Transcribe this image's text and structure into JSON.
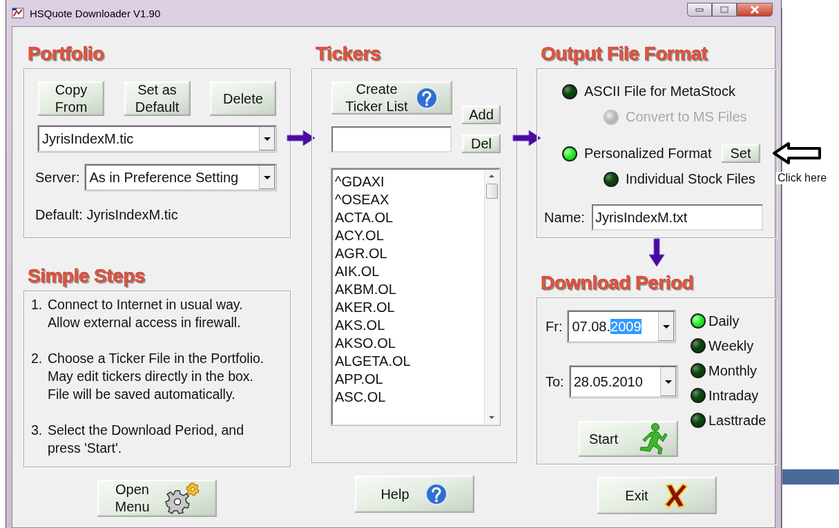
{
  "window": {
    "title": "HSQuote Downloader V1.90"
  },
  "portfolio": {
    "heading": "Portfolio",
    "buttons": [
      {
        "lines": [
          "Copy",
          "From"
        ]
      },
      {
        "lines": [
          "Set as",
          "Default"
        ]
      },
      {
        "lines": [
          "Delete"
        ]
      }
    ],
    "file_select": {
      "value": "JyrisIndexM.tic"
    },
    "server": {
      "label": "Server:",
      "value": "As in Preference Setting"
    },
    "default_text": "Default: JyrisIndexM.tic"
  },
  "simple_steps": {
    "heading": "Simple Steps",
    "steps": [
      {
        "number": "1.",
        "lines": [
          "Connect to Internet in usual way.",
          "Allow external access in firewall."
        ]
      },
      {
        "number": "2.",
        "lines": [
          "Choose a Ticker File in the Portfolio.",
          "May edit tickers directly in the box.",
          "File will be saved automatically."
        ]
      },
      {
        "number": "3.",
        "lines": [
          "Select the Download Period, and",
          "press 'Start'."
        ]
      }
    ]
  },
  "tickers": {
    "heading": "Tickers",
    "create_button": [
      "Create",
      "Ticker List"
    ],
    "add_button": "Add",
    "del_button": "Del",
    "list": [
      "^GDAXI",
      "^OSEAX",
      "ACTA.OL",
      "ACY.OL",
      "AGR.OL",
      "AIK.OL",
      "AKBM.OL",
      "AKER.OL",
      "AKS.OL",
      "AKSO.OL",
      "ALGETA.OL",
      "APP.OL",
      "ASC.OL"
    ]
  },
  "output_format": {
    "heading": "Output File Format",
    "options": [
      {
        "label": "ASCII File for MetaStock",
        "selected": false,
        "disabled": false,
        "children": [
          {
            "label": "Convert to MS Files",
            "selected": false,
            "disabled": true
          }
        ]
      },
      {
        "label": "Personalized Format",
        "selected": true,
        "disabled": false,
        "button": "Set",
        "children": [
          {
            "label": "Individual Stock Files",
            "selected": false,
            "disabled": false
          }
        ]
      }
    ],
    "name_field": {
      "label": "Name:",
      "value": "JyrisIndexM.txt"
    }
  },
  "download_period": {
    "heading": "Download Period",
    "from": {
      "label": "Fr:",
      "value_parts": [
        {
          "text": "07.08.",
          "selected": false
        },
        {
          "text": "2009",
          "selected": true
        }
      ]
    },
    "to": {
      "label": "To:",
      "value_parts": [
        {
          "text": "28.05.2010",
          "selected": false
        }
      ]
    },
    "intervals": [
      {
        "label": "Daily",
        "selected": true
      },
      {
        "label": "Weekly",
        "selected": false
      },
      {
        "label": "Monthly",
        "selected": false
      },
      {
        "label": "Intraday",
        "selected": false
      },
      {
        "label": "Lasttrade",
        "selected": false
      }
    ],
    "start_button": "Start"
  },
  "bottom_buttons": [
    {
      "kind": "menu",
      "lines": [
        "Open",
        "Menu"
      ]
    },
    {
      "kind": "help",
      "lines": [
        "Help"
      ]
    },
    {
      "kind": "exit",
      "lines": [
        "Exit"
      ]
    }
  ],
  "annotation": {
    "text": "Click here"
  }
}
